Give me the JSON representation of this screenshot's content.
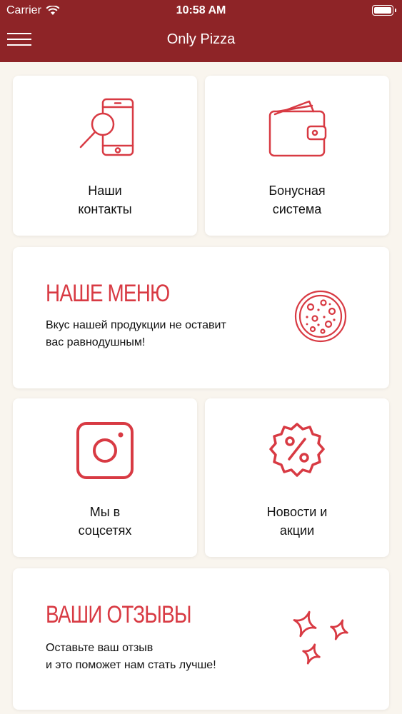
{
  "status_bar": {
    "carrier": "Carrier",
    "time": "10:58 AM"
  },
  "header": {
    "title": "Only Pizza"
  },
  "tiles": {
    "contacts": {
      "line1": "Наши",
      "line2": "контакты"
    },
    "bonus": {
      "line1": "Бонусная",
      "line2": "система"
    },
    "social": {
      "line1": "Мы в",
      "line2": "соцсетях"
    },
    "news": {
      "line1": "Новости и",
      "line2": "акции"
    }
  },
  "menu_banner": {
    "title": "НАШЕ МЕНЮ",
    "desc_line1": "Вкус нашей продукции не оставит",
    "desc_line2": "вас равнодушным!"
  },
  "reviews_banner": {
    "title": "ВАШИ ОТЗЫВЫ",
    "desc_line1": "Оставьте ваш отзыв",
    "desc_line2": "и это поможет нам стать лучше!"
  },
  "colors": {
    "header": "#8e2427",
    "accent": "#d83a43",
    "background": "#f9f5ee"
  },
  "icons": [
    "wifi-icon",
    "battery-icon",
    "hamburger-menu-icon",
    "phone-search-icon",
    "wallet-icon",
    "pizza-icon",
    "instagram-icon",
    "discount-badge-icon",
    "sparkle-stars-icon"
  ]
}
